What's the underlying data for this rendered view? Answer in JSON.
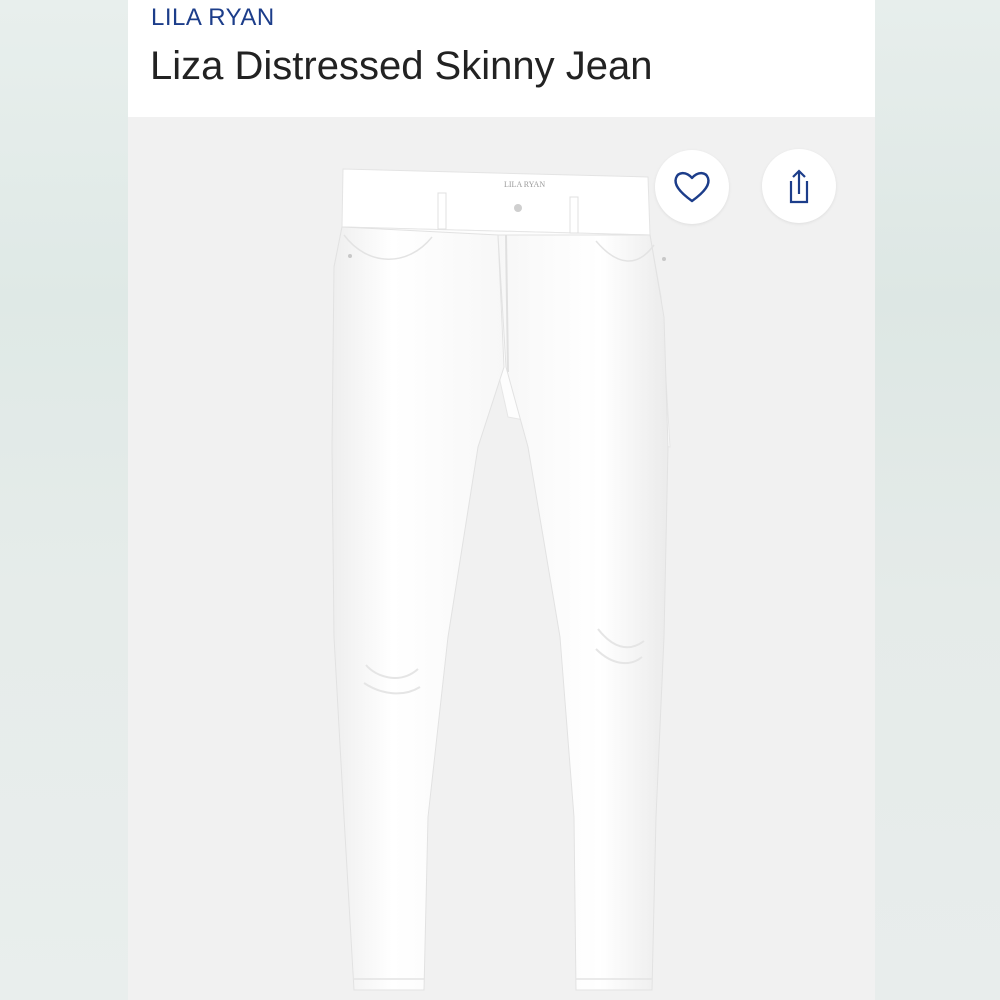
{
  "product": {
    "brand": "LILA RYAN",
    "title": "Liza Distressed Skinny Jean",
    "tag_label": "LILA RYAN"
  },
  "actions": {
    "favorite_icon": "heart-icon",
    "share_icon": "share-icon"
  },
  "colors": {
    "brand": "#1c3d8a",
    "icon": "#1c3d8a",
    "title": "#222222"
  }
}
